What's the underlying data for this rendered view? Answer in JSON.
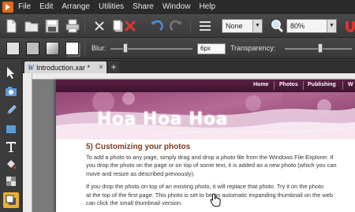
{
  "menu": {
    "items": [
      {
        "label": "File"
      },
      {
        "label": "Edit"
      },
      {
        "label": "Arrange"
      },
      {
        "label": "Utilities"
      },
      {
        "label": "Share"
      },
      {
        "label": "Window"
      },
      {
        "label": "Help"
      }
    ]
  },
  "toolbar": {
    "feather_select": "None",
    "zoom_select": "80%"
  },
  "infobar": {
    "blur_label": "Blur:",
    "blur_value": "6px",
    "transparency_label": "Transparency:"
  },
  "tabs": {
    "active_tab": "Introduction.xar *",
    "add_label": "+"
  },
  "page": {
    "nav": [
      "Home",
      "Photos",
      "Publishing",
      "W"
    ],
    "banner_title": "Hoa Hoa Hoa",
    "heading": "5) Customizing your photos",
    "paragraph1": [
      "To add a photo to any page, simply drag and drop a photo file from the Windows File Explorer. If",
      "you drop the photo on the page or on top of some text, it is added as a new photo (which you can",
      "move and resize as described previously)."
    ],
    "paragraph2": [
      "If you drop the photo on top of an existing photo, it will replace that photo. Try it on the photo",
      "at the top of the first page. This photo is set to be an automatic expanding thumbnail on the web",
      "can click the small thumbnail version."
    ]
  },
  "colors": {
    "banner": "#6b2b52",
    "heading": "#7a3b1b",
    "active_tool": "#e8b030"
  }
}
